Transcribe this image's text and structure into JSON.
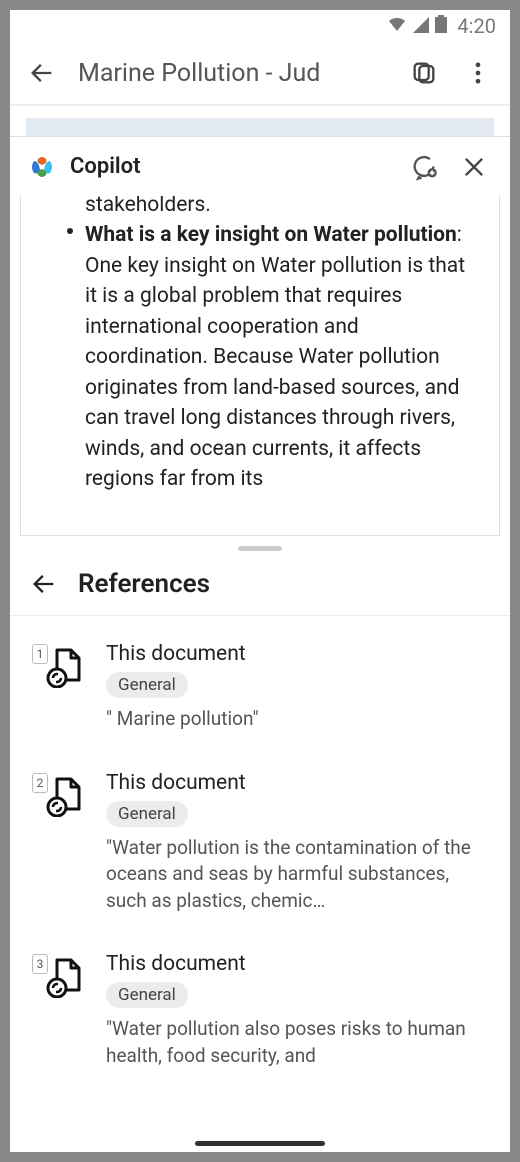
{
  "status": {
    "time": "4:20"
  },
  "header": {
    "title": "Marine Pollution - Jud"
  },
  "copilot": {
    "title": "Copilot",
    "prev_tail": "stakeholders.",
    "insight_label": "What is a key insight on Water pollution",
    "insight_body": ": One key insight on Water pollution is that it is a global problem that requires international cooperation and coordination. Because Water pollution originates from land-based sources, and can travel long distances through rivers, winds, and ocean currents, it affects regions far from its"
  },
  "references": {
    "heading": "References",
    "items": [
      {
        "num": "1",
        "title": "This document",
        "tag": "General",
        "snippet": "\" Marine pollution\""
      },
      {
        "num": "2",
        "title": "This document",
        "tag": "General",
        "snippet": "\"Water pollution is the contamination of the oceans and seas by harmful substances, such as plastics, chemic…"
      },
      {
        "num": "3",
        "title": "This document",
        "tag": "General",
        "snippet": "\"Water pollution also poses risks to human health, food security, and"
      }
    ]
  }
}
